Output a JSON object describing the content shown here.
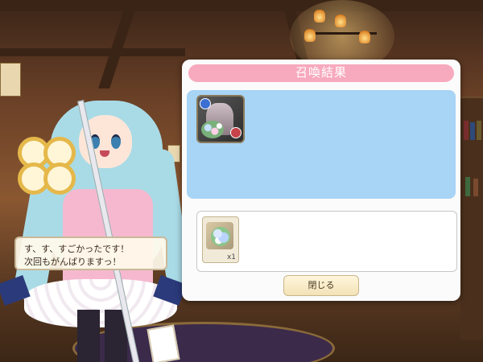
{
  "dialog": {
    "title": "召喚結果",
    "close_label": "閉じる"
  },
  "summon_results": [
    {
      "icon": "unit-card-icon"
    }
  ],
  "rewards": [
    {
      "icon": "flower-bouquet-item-icon",
      "quantity": "x1"
    }
  ],
  "speech": {
    "line1": "す、す、すごかったです！",
    "line2": "次回もがんばりますっ！"
  },
  "colors": {
    "title_bar": "#f7a9bd",
    "summon_area": "#a8d4f6",
    "panel": "#fbfbfb",
    "button": "#f3e2b6"
  }
}
